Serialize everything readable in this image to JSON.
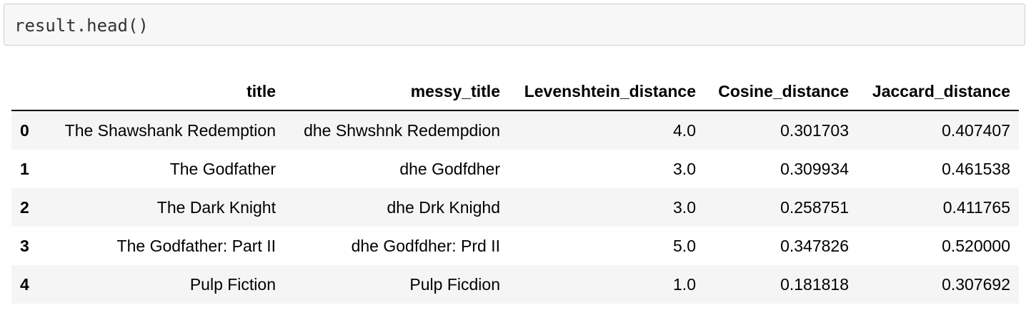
{
  "cell": {
    "code": "result.head()"
  },
  "table": {
    "columns": [
      "",
      "title",
      "messy_title",
      "Levenshtein_distance",
      "Cosine_distance",
      "Jaccard_distance"
    ],
    "rows": [
      {
        "index": "0",
        "title": "The Shawshank Redemption",
        "messy_title": "dhe Shwshnk Redempdion",
        "levenshtein": "4.0",
        "cosine": "0.301703",
        "jaccard": "0.407407"
      },
      {
        "index": "1",
        "title": "The Godfather",
        "messy_title": "dhe Godfdher",
        "levenshtein": "3.0",
        "cosine": "0.309934",
        "jaccard": "0.461538"
      },
      {
        "index": "2",
        "title": "The Dark Knight",
        "messy_title": "dhe Drk Knighd",
        "levenshtein": "3.0",
        "cosine": "0.258751",
        "jaccard": "0.411765"
      },
      {
        "index": "3",
        "title": "The Godfather: Part II",
        "messy_title": "dhe Godfdher: Prd II",
        "levenshtein": "5.0",
        "cosine": "0.347826",
        "jaccard": "0.520000"
      },
      {
        "index": "4",
        "title": "Pulp Fiction",
        "messy_title": "Pulp Ficdion",
        "levenshtein": "1.0",
        "cosine": "0.181818",
        "jaccard": "0.307692"
      }
    ]
  }
}
